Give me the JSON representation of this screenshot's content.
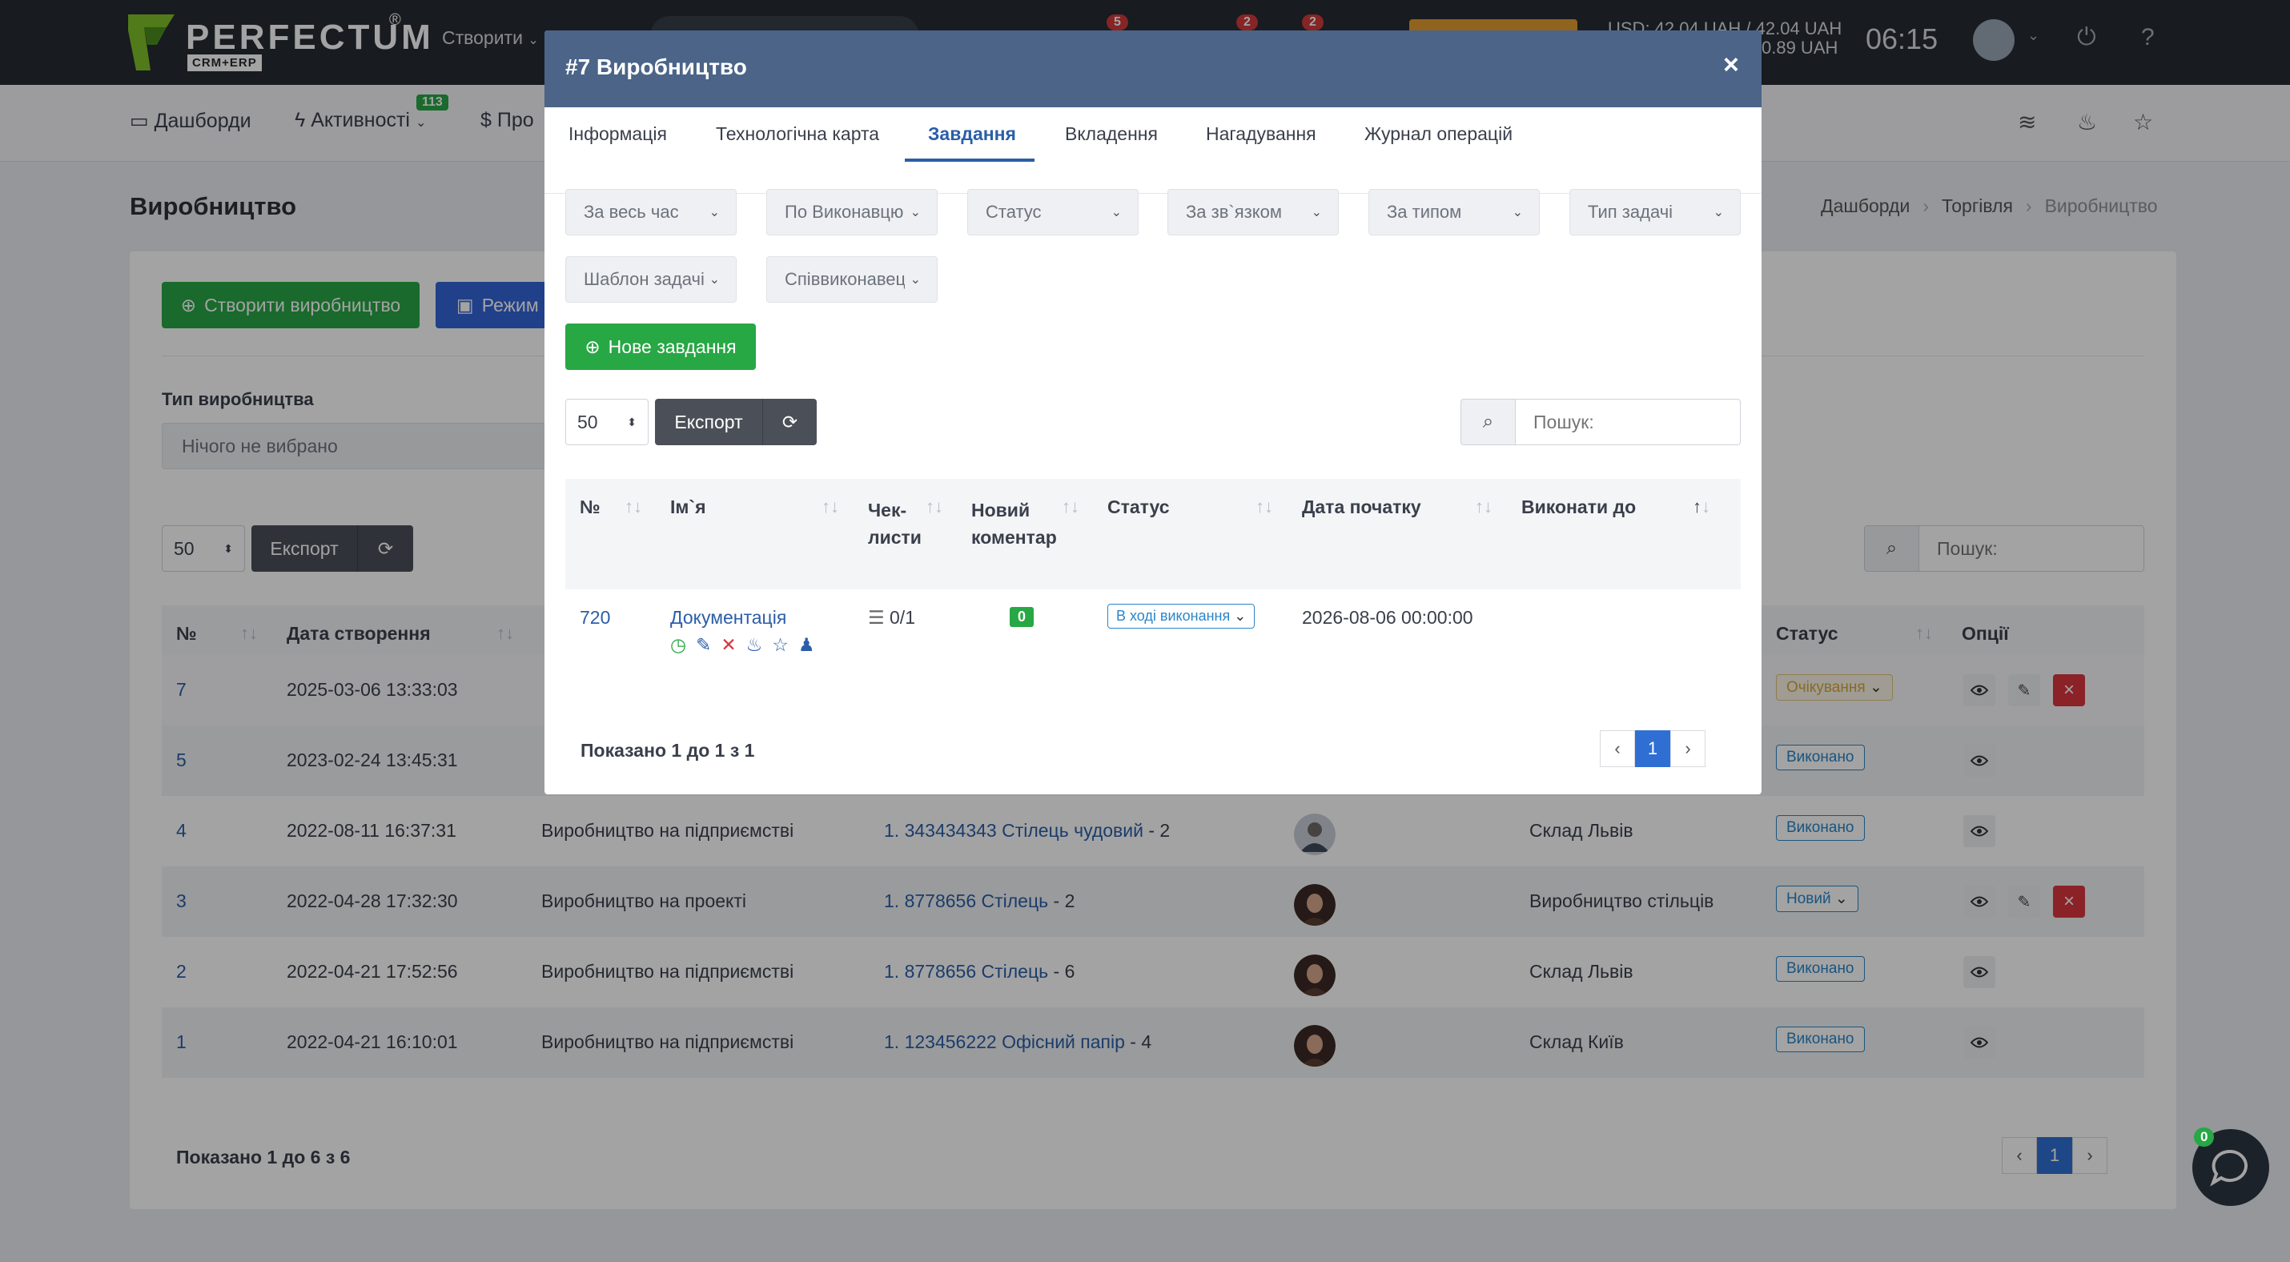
{
  "topbar": {
    "logo_text": "PERFECTUM",
    "logo_reg": "®",
    "logo_sub": "CRM+ERP",
    "create_label": "Створити",
    "badges": [
      "5",
      "2",
      "2"
    ],
    "usd_line1": "USD: 42.04 UAH / 42.04 UAH",
    "usd_line2": "0.89 UAH",
    "clock": "06:15"
  },
  "nav": {
    "items": [
      "Дашборди",
      "Активності",
      "Про"
    ],
    "activities_badge": "113"
  },
  "page": {
    "title": "Виробництво",
    "breadcrumbs": [
      "Дашборди",
      "Торгівля",
      "Виробництво"
    ]
  },
  "card": {
    "create_button": "Створити виробництво",
    "mode_button": "Режим",
    "filter_label": "Тип виробництва",
    "filter_value": "Нічого не вибрано",
    "page_length": "50",
    "export_label": "Експорт",
    "search_placeholder": "Пошук:",
    "columns": [
      "№",
      "Дата створення",
      "Статус",
      "Опції"
    ],
    "rows": [
      {
        "id": "7",
        "date": "2025-03-06 13:33:03",
        "type": "",
        "product": "",
        "warehouse": "",
        "status": "Очікування",
        "status_style": "yellow",
        "has_dropdown": true,
        "options": [
          "view",
          "edit",
          "delete"
        ],
        "avatar": false
      },
      {
        "id": "5",
        "date": "2023-02-24 13:45:31",
        "type": "",
        "product": "",
        "warehouse": "",
        "status": "Виконано",
        "status_style": "blue",
        "has_dropdown": false,
        "options": [
          "view"
        ],
        "avatar": false
      },
      {
        "id": "4",
        "date": "2022-08-11 16:37:31",
        "type": "Виробництво на підприємстві",
        "product": "1. 343434343 Стілець чудовий",
        "qty": " - 2",
        "warehouse": "Склад Львів",
        "status": "Виконано",
        "status_style": "blue",
        "has_dropdown": false,
        "options": [
          "view"
        ],
        "avatar": "man"
      },
      {
        "id": "3",
        "date": "2022-04-28 17:32:30",
        "type": "Виробництво на проекті",
        "product": "1. 8778656 Стілець",
        "qty": " - 2",
        "warehouse": "Виробництво стільців",
        "status": "Новий",
        "status_style": "blue",
        "has_dropdown": true,
        "options": [
          "view",
          "edit",
          "delete"
        ],
        "avatar": "woman"
      },
      {
        "id": "2",
        "date": "2022-04-21 17:52:56",
        "type": "Виробництво на підприємстві",
        "product": "1. 8778656 Стілець",
        "qty": " - 6",
        "warehouse": "Склад Львів",
        "status": "Виконано",
        "status_style": "blue",
        "has_dropdown": false,
        "options": [
          "view"
        ],
        "avatar": "woman"
      },
      {
        "id": "1",
        "date": "2022-04-21 16:10:01",
        "type": "Виробництво на підприємстві",
        "product": "1. 123456222 Офісний папір",
        "qty": " - 4",
        "warehouse": "Склад Київ",
        "status": "Виконано",
        "status_style": "blue",
        "has_dropdown": false,
        "options": [
          "view"
        ],
        "avatar": "woman"
      }
    ],
    "info": "Показано 1 до 6 з 6",
    "current_page": "1"
  },
  "modal": {
    "title": "#7 Виробництво",
    "close": "×",
    "tabs": [
      "Інформація",
      "Технологічна карта",
      "Завдання",
      "Вкладення",
      "Нагадування",
      "Журнал операцій"
    ],
    "active_tab": "Завдання",
    "filters_row1": [
      "За весь час",
      "По Виконавцю",
      "Статус",
      "За зв`язком",
      "За типом",
      "Тип задачі"
    ],
    "filters_row2": [
      "Шаблон задачі",
      "Співвиконавець"
    ],
    "new_task_button": "Нове завдання",
    "page_length": "50",
    "export_label": "Експорт",
    "search_placeholder": "Пошук:",
    "columns": [
      "№",
      "Ім`я",
      "Чек-листи",
      "Новий коментар",
      "Статус",
      "Дата початку",
      "Виконати до"
    ],
    "task": {
      "id": "720",
      "name": "Документація",
      "checklist": "0/1",
      "new_comments": "0",
      "status": "В ході виконання",
      "start_date": "2026-08-06 00:00:00",
      "due_date": ""
    },
    "info": "Показано 1 до 1 з 1",
    "current_page": "1"
  },
  "chat": {
    "badge": "0"
  },
  "colors": {
    "topbar": "#262b33",
    "modal_header": "#4b6488",
    "green": "#28a745",
    "blue": "#3365d6",
    "danger": "#d9363e",
    "link": "#2b5ea8"
  },
  "icons": [
    "caret-down-icon",
    "search-icon",
    "bell-icon",
    "mail-icon",
    "tasks-icon",
    "power-icon",
    "help-icon",
    "dashboard-icon",
    "bolt-icon",
    "dollar-icon",
    "layers-icon",
    "fire-icon",
    "star-icon",
    "plus-circle-icon",
    "board-icon",
    "refresh-icon",
    "sort-icon",
    "eye-icon",
    "pencil-icon",
    "close-icon",
    "clock-icon",
    "user-check-icon",
    "list-icon",
    "chat-icon"
  ]
}
